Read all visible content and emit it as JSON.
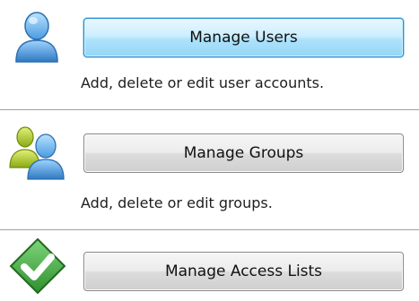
{
  "sections": [
    {
      "button_label": "Manage Users",
      "description": "Add, delete or edit user accounts.",
      "icon": "user-icon",
      "highlighted": true
    },
    {
      "button_label": "Manage Groups",
      "description": "Add, delete or edit groups.",
      "icon": "group-icon",
      "highlighted": false
    },
    {
      "button_label": "Manage Access Lists",
      "icon": "checkmark-shield-icon",
      "highlighted": false
    }
  ],
  "colors": {
    "highlight_button": "#aee2fb",
    "highlight_border": "#2b8fd0",
    "divider": "#a0a0a0",
    "user_blue": "#3f8fd6",
    "group_green": "#a8c81f",
    "check_green": "#3f9d3f"
  }
}
